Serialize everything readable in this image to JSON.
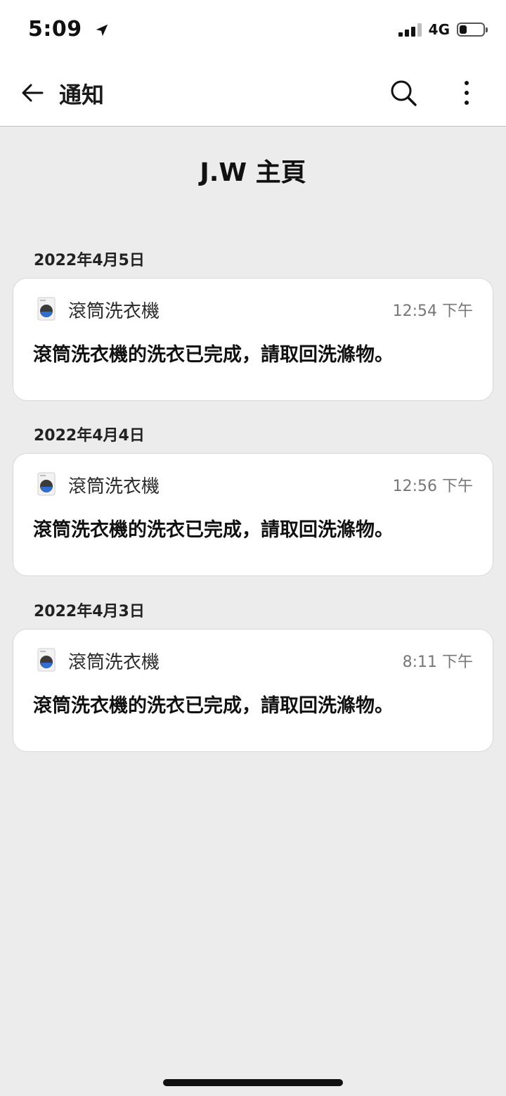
{
  "status_bar": {
    "time": "5:09",
    "network": "4G",
    "battery_level": 0.3
  },
  "app_bar": {
    "title": "通知"
  },
  "page": {
    "title": "J.W 主頁"
  },
  "notifications": [
    {
      "date": "2022年4月5日",
      "device": "滾筒洗衣機",
      "time": "12:54 下午",
      "message": "滾筒洗衣機的洗衣已完成，請取回洗滌物。"
    },
    {
      "date": "2022年4月4日",
      "device": "滾筒洗衣機",
      "time": "12:56 下午",
      "message": "滾筒洗衣機的洗衣已完成，請取回洗滌物。"
    },
    {
      "date": "2022年4月3日",
      "device": "滾筒洗衣機",
      "time": "8:11 下午",
      "message": "滾筒洗衣機的洗衣已完成，請取回洗滌物。"
    }
  ],
  "icons": {
    "back": "arrow-left-icon",
    "search": "search-icon",
    "more": "more-vertical-icon",
    "device": "washing-machine-icon",
    "location": "location-arrow-icon"
  },
  "colors": {
    "background": "#ececec",
    "card": "#ffffff",
    "drum_blue": "#2f6fd1"
  }
}
